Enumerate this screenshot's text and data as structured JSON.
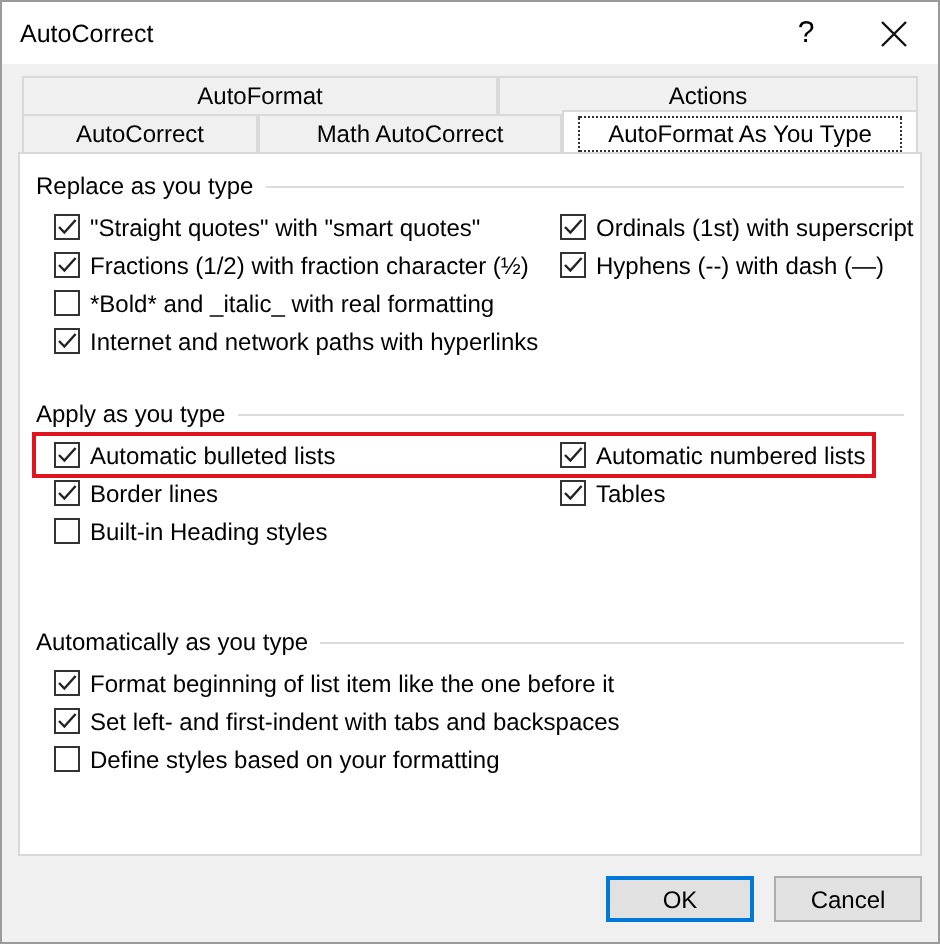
{
  "window": {
    "title": "AutoCorrect",
    "help": "?"
  },
  "tab_rows": [
    [
      {
        "label": "AutoFormat",
        "selected": false
      },
      {
        "label": "Actions",
        "selected": false
      }
    ],
    [
      {
        "label": "AutoCorrect",
        "selected": false
      },
      {
        "label": "Math AutoCorrect",
        "selected": false
      },
      {
        "label": "AutoFormat As You Type",
        "selected": true
      }
    ]
  ],
  "sections": [
    {
      "heading": "Replace as you type",
      "rows": [
        {
          "highlighted": false,
          "items": [
            {
              "label": "\"Straight quotes\" with \"smart quotes\"",
              "checked": true
            },
            {
              "label": "Ordinals (1st) with superscript",
              "checked": true
            }
          ]
        },
        {
          "highlighted": false,
          "items": [
            {
              "label": "Fractions (1/2) with fraction character (½)",
              "checked": true
            },
            {
              "label": "Hyphens (--) with dash (—)",
              "checked": true
            }
          ]
        },
        {
          "highlighted": false,
          "items": [
            {
              "label": "*Bold* and _italic_ with real formatting",
              "checked": false
            }
          ]
        },
        {
          "highlighted": false,
          "items": [
            {
              "label": "Internet and network paths with hyperlinks",
              "checked": true
            }
          ]
        }
      ]
    },
    {
      "heading": "Apply as you type",
      "rows": [
        {
          "highlighted": true,
          "items": [
            {
              "label": "Automatic bulleted lists",
              "checked": true
            },
            {
              "label": "Automatic numbered lists",
              "checked": true
            }
          ]
        },
        {
          "highlighted": false,
          "items": [
            {
              "label": "Border lines",
              "checked": true
            },
            {
              "label": "Tables",
              "checked": true
            }
          ]
        },
        {
          "highlighted": false,
          "items": [
            {
              "label": "Built-in Heading styles",
              "checked": false
            }
          ]
        }
      ]
    },
    {
      "heading": "Automatically as you type",
      "rows": [
        {
          "highlighted": false,
          "items": [
            {
              "label": "Format beginning of list item like the one before it",
              "checked": true
            }
          ]
        },
        {
          "highlighted": false,
          "items": [
            {
              "label": "Set left- and first-indent with tabs and backspaces",
              "checked": true
            }
          ]
        },
        {
          "highlighted": false,
          "items": [
            {
              "label": "Define styles based on your formatting",
              "checked": false
            }
          ]
        }
      ]
    }
  ],
  "buttons": [
    {
      "label": "OK",
      "default": true
    },
    {
      "label": "Cancel",
      "default": false
    }
  ]
}
